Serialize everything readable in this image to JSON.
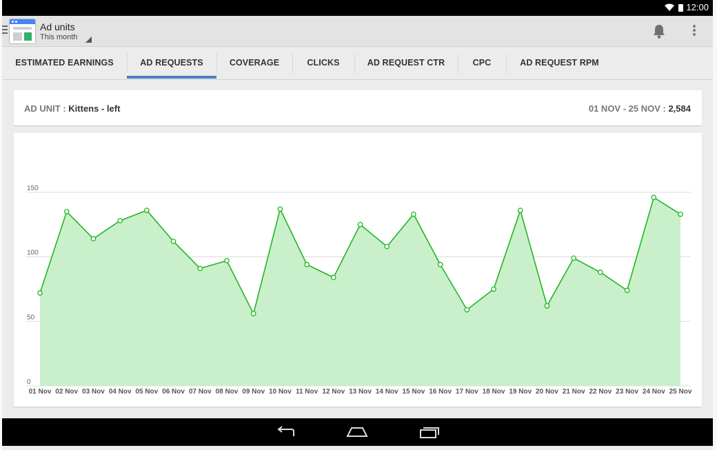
{
  "status_bar": {
    "time": "12:00",
    "icons": [
      "wifi-icon",
      "battery-icon"
    ]
  },
  "action_bar": {
    "title": "Ad units",
    "subtitle": "This month",
    "icons": [
      "menu-icon",
      "app-icon",
      "bell-icon",
      "overflow-menu-icon"
    ]
  },
  "tabs": [
    {
      "label": "ESTIMATED EARNINGS",
      "active": false
    },
    {
      "label": "AD REQUESTS",
      "active": true
    },
    {
      "label": "COVERAGE",
      "active": false
    },
    {
      "label": "CLICKS",
      "active": false
    },
    {
      "label": "AD REQUEST CTR",
      "active": false
    },
    {
      "label": "CPC",
      "active": false
    },
    {
      "label": "AD REQUEST RPM",
      "active": false
    }
  ],
  "header": {
    "ad_unit_label": "AD UNIT : ",
    "ad_unit_value": "Kittens - left",
    "range_label": "01 NOV - 25 NOV : ",
    "range_value": "2,584"
  },
  "colors": {
    "accent": "#4a7fc1",
    "line": "#22b522",
    "fill": "#c9f0cb"
  },
  "chart_data": {
    "type": "area",
    "categories": [
      "01 Nov",
      "02 Nov",
      "03 Nov",
      "04 Nov",
      "05 Nov",
      "06 Nov",
      "07 Nov",
      "08 Nov",
      "09 Nov",
      "10 Nov",
      "11 Nov",
      "12 Nov",
      "13 Nov",
      "14 Nov",
      "15 Nov",
      "16 Nov",
      "17 Nov",
      "18 Nov",
      "19 Nov",
      "20 Nov",
      "21 Nov",
      "22 Nov",
      "23 Nov",
      "24 Nov",
      "25 Nov"
    ],
    "values": [
      72,
      135,
      114,
      128,
      136,
      112,
      91,
      97,
      56,
      137,
      94,
      84,
      125,
      108,
      133,
      94,
      59,
      75,
      136,
      62,
      99,
      88,
      74,
      146,
      133
    ],
    "yticks": [
      0,
      50,
      100,
      150
    ],
    "ylim": [
      0,
      150
    ],
    "grid": true,
    "legend": "none"
  },
  "nav_bar": {
    "icons": [
      "back-icon",
      "home-icon",
      "recents-icon"
    ]
  }
}
